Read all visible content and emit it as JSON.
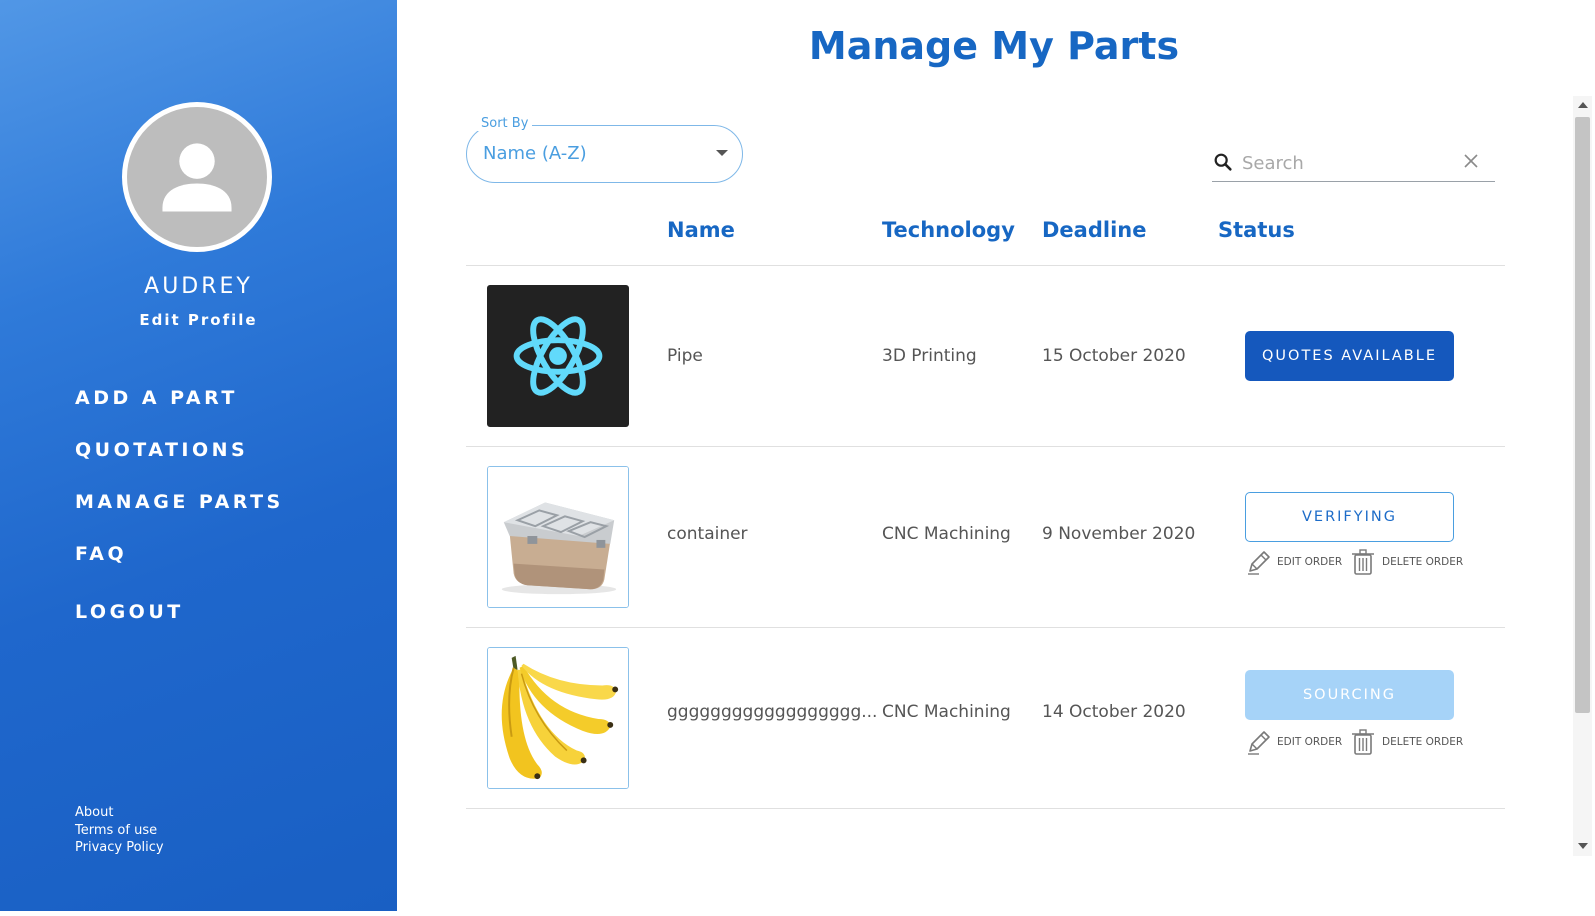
{
  "sidebar": {
    "user_name": "AUDREY",
    "edit_profile": "Edit Profile",
    "nav": [
      {
        "label": "ADD A PART"
      },
      {
        "label": "QUOTATIONS"
      },
      {
        "label": "MANAGE PARTS"
      },
      {
        "label": "FAQ"
      },
      {
        "label": "LOGOUT"
      }
    ],
    "footer": [
      {
        "label": "About"
      },
      {
        "label": "Terms of use"
      },
      {
        "label": "Privacy Policy"
      }
    ]
  },
  "main": {
    "title": "Manage My Parts",
    "sort": {
      "legend": "Sort By",
      "value": "Name (A-Z)"
    },
    "search": {
      "placeholder": "Search"
    },
    "columns": {
      "name": "Name",
      "technology": "Technology",
      "deadline": "Deadline",
      "status": "Status"
    },
    "rows": [
      {
        "image": "react-logo",
        "name": "Pipe",
        "technology": "3D Printing",
        "deadline": "15 October 2020",
        "status": "QUOTES AVAILABLE"
      },
      {
        "image": "storage-container",
        "name": "container",
        "technology": "CNC Machining",
        "deadline": "9 November 2020",
        "status": "VERIFYING",
        "edit": "EDIT ORDER",
        "delete": "DELETE ORDER"
      },
      {
        "image": "bananas",
        "name": "gggggggggggggggggg...",
        "technology": "CNC Machining",
        "deadline": "14 October 2020",
        "status": "SOURCING",
        "edit": "EDIT ORDER",
        "delete": "DELETE ORDER"
      }
    ]
  },
  "colors": {
    "brand_blue": "#1767c3",
    "quotes_button": "#1558bd",
    "sourcing_button": "#a6d3f8",
    "sidebar_gradient_start": "#5197e6",
    "sidebar_gradient_end": "#195fc3"
  }
}
